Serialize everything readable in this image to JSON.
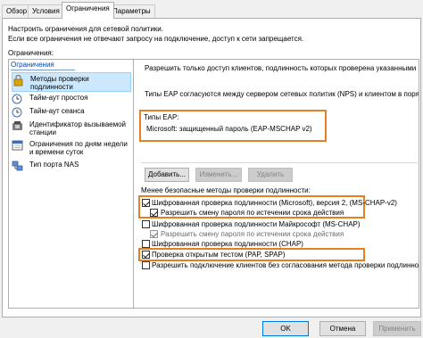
{
  "tabs": [
    "Обзор",
    "Условия",
    "Ограничения",
    "Параметры"
  ],
  "description": "Настроить ограничения для сетевой политики.\nЕсли все ограничения не отвечают запросу на подключение, доступ к сети запрещается.",
  "group_label": "Ограничения:",
  "list_header": "Ограничения",
  "left_items": [
    {
      "label": "Методы проверки подлинности",
      "icon": "lock-icon",
      "selected": true
    },
    {
      "label": "Тайм-аут простоя",
      "icon": "clock-icon",
      "selected": false
    },
    {
      "label": "Тайм-аут сеанса",
      "icon": "clock-icon",
      "selected": false
    },
    {
      "label": "Идентификатор вызываемой станции",
      "icon": "phone-icon",
      "selected": false
    },
    {
      "label": "Ограничения по дням недели и времени суток",
      "icon": "calendar-icon",
      "selected": false
    },
    {
      "label": "Тип порта NAS",
      "icon": "network-icon",
      "selected": false
    }
  ],
  "right": {
    "intro": "Разрешить только доступ клиентов, подлинность которых проверена указанными мет",
    "eap_note": "Типы EAP согласуются между сервером сетевых политик (NPS) и клиентом в порядке",
    "eap_types_label": "Типы EAP:",
    "eap_item": "Microsoft: защищенный пароль (EAP-MSCHAP v2)",
    "buttons": {
      "add": "Добавить...",
      "edit": "Изменить...",
      "remove": "Удалить"
    },
    "less_secure_label": "Менее безопасные методы проверки подлинности:",
    "methods": [
      {
        "label": "Шифрованная проверка подлинности (Microsoft), версия 2, (MS-CHAP-v2)",
        "checked": true,
        "disabled": false
      },
      {
        "label": "Разрешить смену пароля по истечении срока действия",
        "checked": true,
        "disabled": false
      },
      {
        "label": "Шифрованная проверка подлинности Майкрософт (MS-CHAP)",
        "checked": false,
        "disabled": false
      },
      {
        "label": "Разрешить смену пароля по истечении срока действия",
        "checked": true,
        "disabled": true
      },
      {
        "label": "Шифрованная проверка подлинности (CHAP)",
        "checked": false,
        "disabled": false
      },
      {
        "label": "Проверка открытым тестом (PAP, SPAP)",
        "checked": true,
        "disabled": false
      },
      {
        "label": "Разрешить подключение клиентов без согласования метода проверки подлинности",
        "checked": false,
        "disabled": false
      }
    ]
  },
  "footer": {
    "ok": "OK",
    "cancel": "Отмена",
    "apply": "Применить"
  },
  "accent": "#e67e22"
}
